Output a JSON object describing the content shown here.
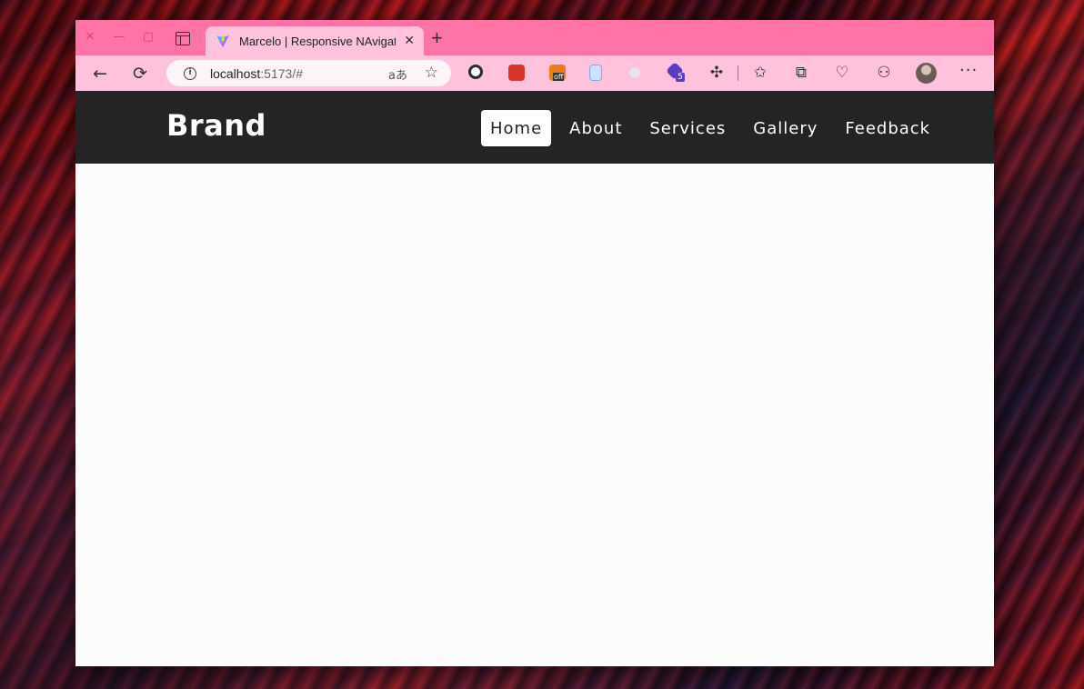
{
  "window": {
    "close_glyph": "✕",
    "minimize_glyph": "—",
    "maximize_glyph": "▢"
  },
  "tab": {
    "title": "Marcelo | Responsive NAvigation Bar",
    "close_glyph": "✕",
    "favicon": "vite-icon"
  },
  "new_tab_glyph": "+",
  "toolbar": {
    "back_glyph": "←",
    "refresh_glyph": "⟳",
    "url_host": "localhost",
    "url_rest": ":5173/#",
    "read_aloud": "aあ",
    "menu_glyph": "···"
  },
  "extensions": [
    {
      "name": "circle-extension-icon",
      "color": "#2b2b2b"
    },
    {
      "name": "ladybug-extension-icon",
      "color": "#d9362b"
    },
    {
      "name": "off-extension-icon",
      "color": "#f07a1a",
      "label": "off"
    },
    {
      "name": "clipboard-extension-icon",
      "color": "#7fa6e6"
    },
    {
      "name": "sparkle-extension-icon",
      "color": "#e9e2f0"
    },
    {
      "name": "cube-extension-icon",
      "color": "#5b3bc4",
      "badge": "5"
    }
  ],
  "site": {
    "brand": "Brand",
    "nav": [
      {
        "label": "Home",
        "active": true
      },
      {
        "label": "About",
        "active": false
      },
      {
        "label": "Services",
        "active": false
      },
      {
        "label": "Gallery",
        "active": false
      },
      {
        "label": "Feedback",
        "active": false
      }
    ]
  },
  "colors": {
    "titlebar": "#ff73a6",
    "toolbar": "#ffc2dc",
    "site_nav_bg": "#242424",
    "page_bg": "#fcfcfc"
  }
}
